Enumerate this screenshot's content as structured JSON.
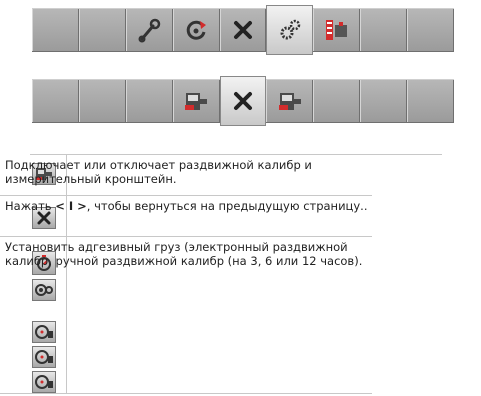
{
  "toolbar1": {
    "buttons": [
      {
        "icon": "empty-slot"
      },
      {
        "icon": "empty-slot"
      },
      {
        "icon": "wrench-icon"
      },
      {
        "icon": "rotate-icon"
      },
      {
        "icon": "close-icon"
      },
      {
        "icon": "gears-icon"
      },
      {
        "icon": "caliper-icon"
      },
      {
        "icon": "empty-slot"
      },
      {
        "icon": "empty-slot"
      }
    ]
  },
  "toolbar2": {
    "buttons": [
      {
        "icon": "empty-slot"
      },
      {
        "icon": "empty-slot"
      },
      {
        "icon": "empty-slot"
      },
      {
        "icon": "caliper-icon"
      },
      {
        "icon": "close-icon"
      },
      {
        "icon": "caliper-icon"
      },
      {
        "icon": "empty-slot"
      },
      {
        "icon": "empty-slot"
      },
      {
        "icon": "empty-slot"
      }
    ]
  },
  "legend": {
    "caliper": {
      "text": "Подключает или отключает раздвижной калибр и измерительный кронштейн."
    },
    "close": {
      "pre": "Нажать ",
      "key": "< I >",
      "post": ", чтобы вернуться на предыдущую страницу.."
    },
    "weight": {
      "text": "Установить адгезивный груз (электронный раздвижной калибр, ручной раздвижной калибр (на 3, 6 или 12 часов)."
    }
  },
  "colors": {
    "toolbar": "#9a9a9a",
    "active": "#e6e6e6",
    "red": "#d22c2c"
  }
}
